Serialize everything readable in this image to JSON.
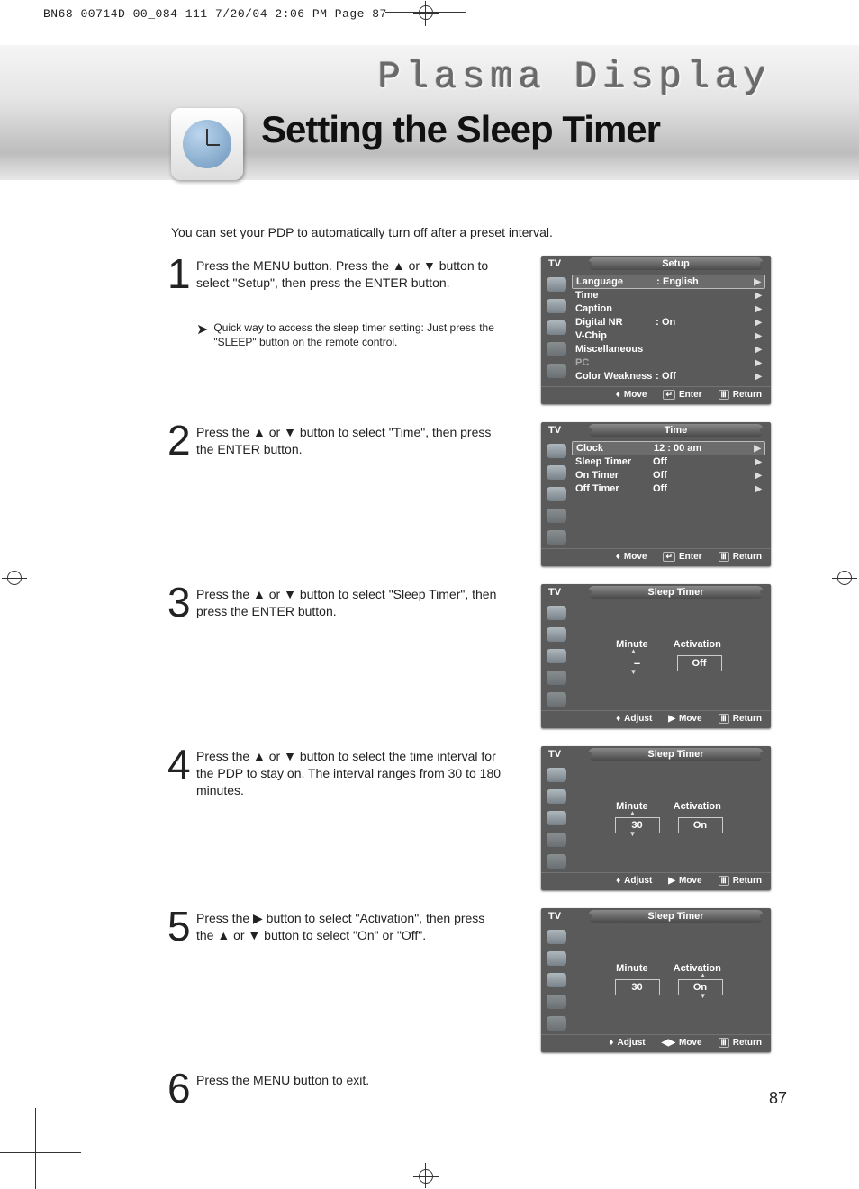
{
  "header_slug": "BN68-00714D-00_084-111  7/20/04  2:06 PM  Page 87",
  "brand": "Plasma Display",
  "title": "Setting the Sleep Timer",
  "intro": "You can set your PDP to automatically turn off after a preset interval.",
  "page_number": "87",
  "footer": {
    "move": "Move",
    "enter": "Enter",
    "return": "Return",
    "adjust": "Adjust"
  },
  "osd_common": {
    "tv": "TV",
    "minute": "Minute",
    "activation": "Activation"
  },
  "steps": [
    {
      "num": "1",
      "text": "Press the MENU button. Press the ▲ or ▼ button to select \"Setup\", then press the ENTER button.",
      "tip": "Quick way to access the sleep timer setting: Just press the \"SLEEP\" button on the remote control.",
      "osd": {
        "title": "Setup",
        "rows": [
          {
            "label": "Language",
            "colon": ":",
            "value": "English",
            "selected": true
          },
          {
            "label": "Time",
            "value": ""
          },
          {
            "label": "Caption",
            "value": ""
          },
          {
            "label": "Digital NR",
            "colon": ":",
            "value": "On"
          },
          {
            "label": "V-Chip",
            "value": ""
          },
          {
            "label": "Miscellaneous",
            "value": ""
          },
          {
            "label": "PC",
            "value": "",
            "dim": true
          },
          {
            "label": "Color Weakness",
            "colon": ":",
            "value": "Off"
          }
        ],
        "footer": [
          "move",
          "enter",
          "return"
        ]
      }
    },
    {
      "num": "2",
      "text": "Press the ▲ or ▼ button to select \"Time\", then press the ENTER button.",
      "osd": {
        "title": "Time",
        "rows": [
          {
            "label": "Clock",
            "value": "12 : 00 am",
            "selected": true
          },
          {
            "label": "Sleep Timer",
            "value": "Off"
          },
          {
            "label": "On Timer",
            "value": "Off"
          },
          {
            "label": "Off Timer",
            "value": "Off"
          }
        ],
        "footer": [
          "move",
          "enter",
          "return"
        ]
      }
    },
    {
      "num": "3",
      "text": "Press the ▲ or ▼ button to select \"Sleep Timer\", then press the ENTER button.",
      "osd": {
        "title": "Sleep Timer",
        "sleep": {
          "minute": "--",
          "minute_box": true,
          "activation": "Off",
          "activation_box": true,
          "arrows_left": true
        },
        "footer": [
          "adjust",
          "move_right",
          "return"
        ]
      }
    },
    {
      "num": "4",
      "text": "Press the ▲ or ▼ button to select the time interval for the PDP to stay on. The interval ranges from 30 to 180 minutes.",
      "osd": {
        "title": "Sleep Timer",
        "sleep": {
          "minute": "30",
          "minute_box": true,
          "activation": "On",
          "activation_box": true,
          "arrows_left": true
        },
        "footer": [
          "adjust",
          "move_right",
          "return"
        ]
      }
    },
    {
      "num": "5",
      "text": "Press the ▶ button to select \"Activation\", then press the ▲ or ▼ button to select \"On\" or \"Off\".",
      "osd": {
        "title": "Sleep Timer",
        "sleep": {
          "minute": "30",
          "minute_box": true,
          "activation": "On",
          "activation_box": true,
          "arrows_right": true
        },
        "footer": [
          "adjust",
          "move_lr",
          "return"
        ]
      }
    },
    {
      "num": "6",
      "text": "Press the MENU button to exit."
    }
  ]
}
